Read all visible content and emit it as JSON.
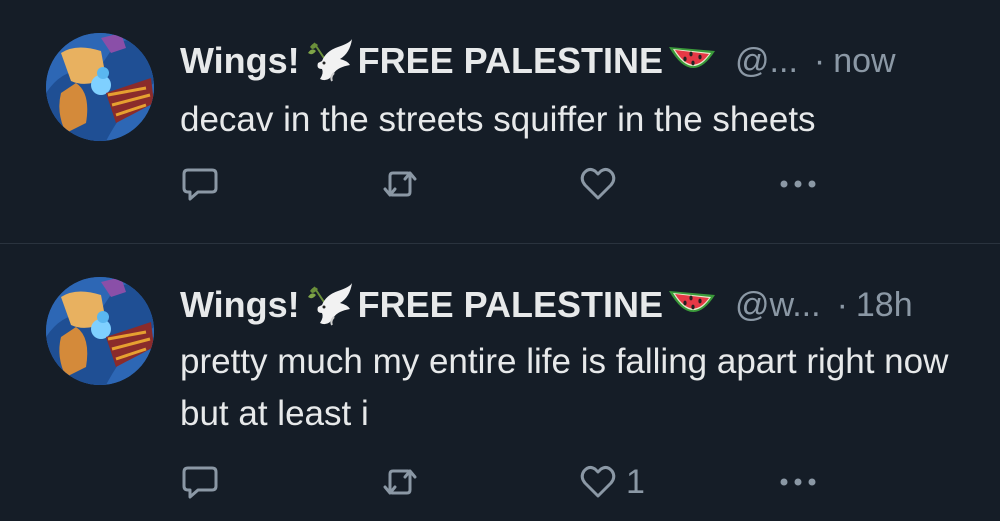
{
  "theme": {
    "background": "#151d27",
    "text": "#e7e9ea",
    "muted": "#8b98a5",
    "divider": "#2a333e"
  },
  "tweets": [
    {
      "display_name": {
        "prefix": "Wings!",
        "suffix": "FREE PALESTINE"
      },
      "emoji": [
        "dove-with-olive-branch",
        "watermelon"
      ],
      "handle": "@...",
      "separator": "·",
      "time": "now",
      "text": "decav in the streets squiffer in the sheets",
      "actions": {
        "reply_icon": "reply-icon",
        "retweet_icon": "retweet-icon",
        "like_icon": "like-icon",
        "like_count": "",
        "more_icon": "more-icon"
      }
    },
    {
      "display_name": {
        "prefix": "Wings!",
        "suffix": "FREE PALESTINE"
      },
      "emoji": [
        "dove-with-olive-branch",
        "watermelon"
      ],
      "handle": "@w...",
      "separator": "·",
      "time": "18h",
      "text": "pretty much my entire life is falling apart right now but at least i",
      "actions": {
        "reply_icon": "reply-icon",
        "retweet_icon": "retweet-icon",
        "like_icon": "like-icon",
        "like_count": "1",
        "more_icon": "more-icon"
      }
    }
  ]
}
